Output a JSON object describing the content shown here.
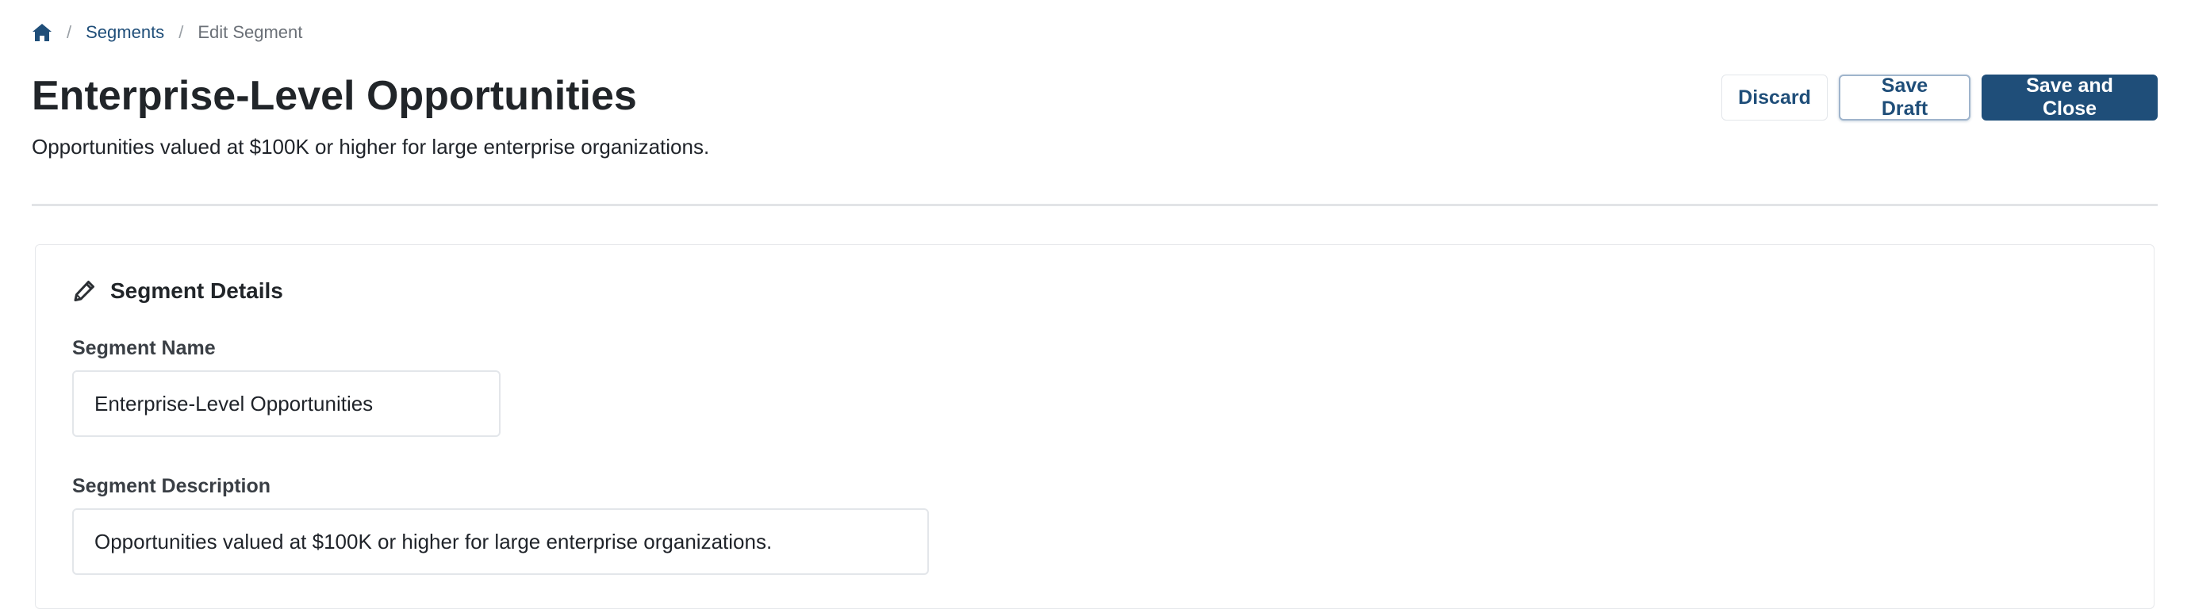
{
  "breadcrumb": {
    "home_icon": "home-icon",
    "separator": "/",
    "segments_link": "Segments",
    "current": "Edit Segment"
  },
  "header": {
    "title": "Enterprise-Level Opportunities",
    "description": "Opportunities valued at $100K or higher for large enterprise organizations."
  },
  "actions": {
    "discard_label": "Discard",
    "save_draft_label": "Save Draft",
    "save_close_label": "Save and Close"
  },
  "card": {
    "icon": "pencil-icon",
    "title": "Segment Details",
    "name_label": "Segment Name",
    "name_value": "Enterprise-Level Opportunities",
    "description_label": "Segment Description",
    "description_value": "Opportunities valued at $100K or higher for large enterprise organizations."
  },
  "colors": {
    "primary": "#1f4e79",
    "text": "#212529",
    "muted": "#6b7077",
    "border": "#e3e6ea"
  }
}
